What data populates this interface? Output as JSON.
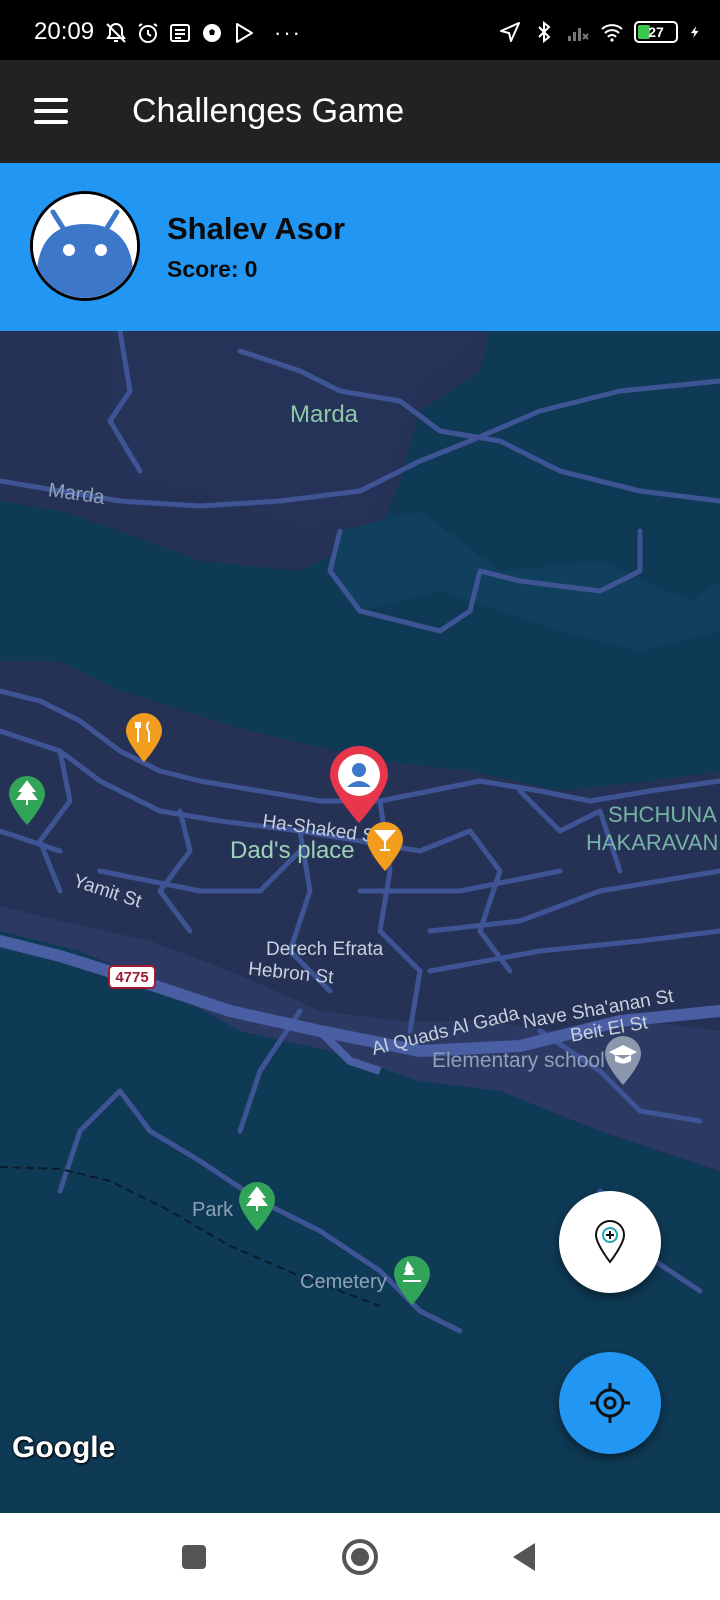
{
  "status_bar": {
    "time": "20:09",
    "battery": "27",
    "left_icons": [
      "mute-icon",
      "alarm-icon",
      "news-icon",
      "soccer-icon",
      "play-store-icon"
    ],
    "more": "···"
  },
  "app_bar": {
    "title": "Challenges Game",
    "menu_icon": "hamburger-menu-icon"
  },
  "profile": {
    "name": "Shalev Asor",
    "score_label": "Score:",
    "score_value": "0",
    "avatar_icon": "android-avatar-icon"
  },
  "map": {
    "labels": {
      "marda_center": "Marda",
      "marda_left": "Marda",
      "ha_shaked": "Ha-Shaked St",
      "dads_place": "Dad's place",
      "district_line1": "SHCHUNA",
      "district_line2": "HAKARAVAN",
      "yamit": "Yamit St",
      "derech_efrata": "Derech Efrata",
      "hebron": "Hebron St",
      "al_quads": "Al Quads Al Gada",
      "nave_shaanan": "Nave Sha'anan St",
      "beit_el": "Beit El St",
      "elementary": "Elementary school",
      "park": "Park",
      "cemetery": "Cemetery",
      "road_number": "4775"
    },
    "google_logo": "Google",
    "colors": {
      "water_bg": "#0e3a55",
      "land": "#253256",
      "road": "#3f5494",
      "user_pin": "#e8364a",
      "food_pin": "#f29d1d",
      "park_pin": "#31a45a"
    }
  },
  "fabs": {
    "add_challenge_icon": "add-location-pin-icon",
    "my_location_icon": "gps-crosshair-icon",
    "primary_color": "#2196F3"
  },
  "nav_bar": {
    "recents_icon": "square-recents-icon",
    "home_icon": "circle-home-icon",
    "back_icon": "triangle-back-icon"
  }
}
